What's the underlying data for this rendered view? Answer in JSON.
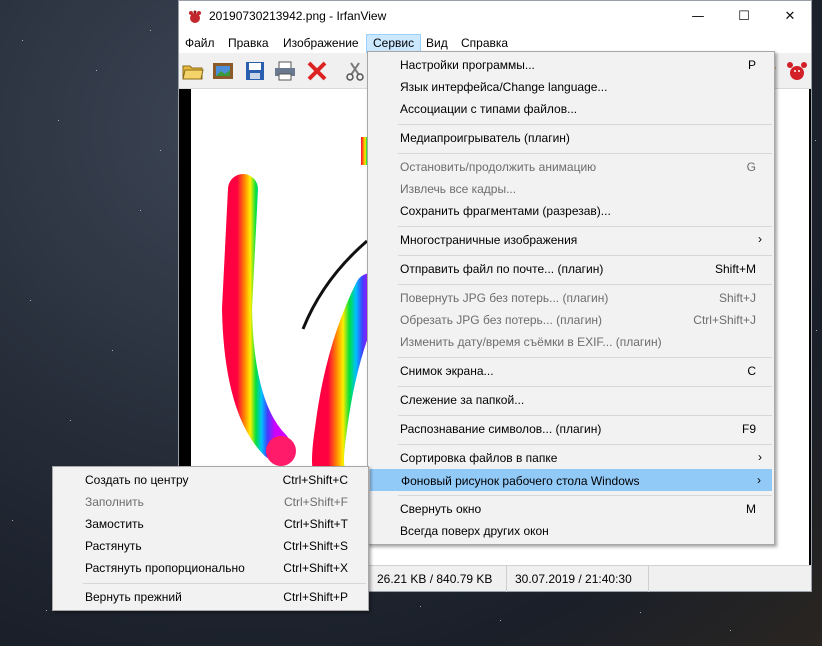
{
  "window": {
    "title": "20190730213942.png - IrfanView",
    "minimize_glyph": "—",
    "maximize_glyph": "☐",
    "close_glyph": "✕"
  },
  "menubar": {
    "items": [
      "Файл",
      "Правка",
      "Изображение",
      "Сервис",
      "Вид",
      "Справка"
    ]
  },
  "toolbar": {
    "icons": [
      "open-folder-icon",
      "slideshow-icon",
      "save-icon",
      "print-icon",
      "delete-icon",
      "cut-icon"
    ],
    "right_icons": [
      "paint-icon",
      "irfanview-logo-icon"
    ]
  },
  "status": {
    "size": "26.21 KB / 840.79 KB",
    "datetime": "30.07.2019 / 21:40:30"
  },
  "service_menu": {
    "items": [
      {
        "label": "Настройки программы...",
        "shortcut": "P"
      },
      {
        "label": "Язык интерфейса/Change language...",
        "shortcut": ""
      },
      {
        "label": "Ассоциации с типами файлов...",
        "shortcut": ""
      },
      {
        "label": "Медиапроигрыватель (плагин)",
        "shortcut": ""
      },
      {
        "label": "Остановить/продолжить анимацию",
        "shortcut": "G"
      },
      {
        "label": "Извлечь все кадры...",
        "shortcut": ""
      },
      {
        "label": "Сохранить фрагментами (разрезав)...",
        "shortcut": ""
      },
      {
        "label": "Многостраничные изображения",
        "shortcut": ""
      },
      {
        "label": "Отправить файл по почте... (плагин)",
        "shortcut": "Shift+M"
      },
      {
        "label": "Повернуть JPG без потерь... (плагин)",
        "shortcut": "Shift+J"
      },
      {
        "label": "Обрезать JPG без потерь... (плагин)",
        "shortcut": "Ctrl+Shift+J"
      },
      {
        "label": "Изменить дату/время съёмки в EXIF... (плагин)",
        "shortcut": ""
      },
      {
        "label": "Снимок экрана...",
        "shortcut": "C"
      },
      {
        "label": "Слежение за папкой...",
        "shortcut": ""
      },
      {
        "label": "Распознавание символов... (плагин)",
        "shortcut": "F9"
      },
      {
        "label": "Сортировка файлов в папке",
        "shortcut": ""
      },
      {
        "label": "Фоновый рисунок рабочего стола Windows",
        "shortcut": ""
      },
      {
        "label": "Свернуть окно",
        "shortcut": "M"
      },
      {
        "label": "Всегда поверх других окон",
        "shortcut": ""
      }
    ]
  },
  "wallpaper_submenu": {
    "items": [
      {
        "label": "Создать по центру",
        "shortcut": "Ctrl+Shift+C"
      },
      {
        "label": "Заполнить",
        "shortcut": "Ctrl+Shift+F"
      },
      {
        "label": "Замостить",
        "shortcut": "Ctrl+Shift+T"
      },
      {
        "label": "Растянуть",
        "shortcut": "Ctrl+Shift+S"
      },
      {
        "label": "Растянуть пропорционально",
        "shortcut": "Ctrl+Shift+X"
      },
      {
        "label": "Вернуть прежний",
        "shortcut": "Ctrl+Shift+P"
      }
    ]
  },
  "colors": {
    "highlight": "#91c9f7",
    "menu_bg": "#f2f2f2",
    "active_menu": "#cce8ff",
    "disabled_text": "#6d6d6d"
  }
}
